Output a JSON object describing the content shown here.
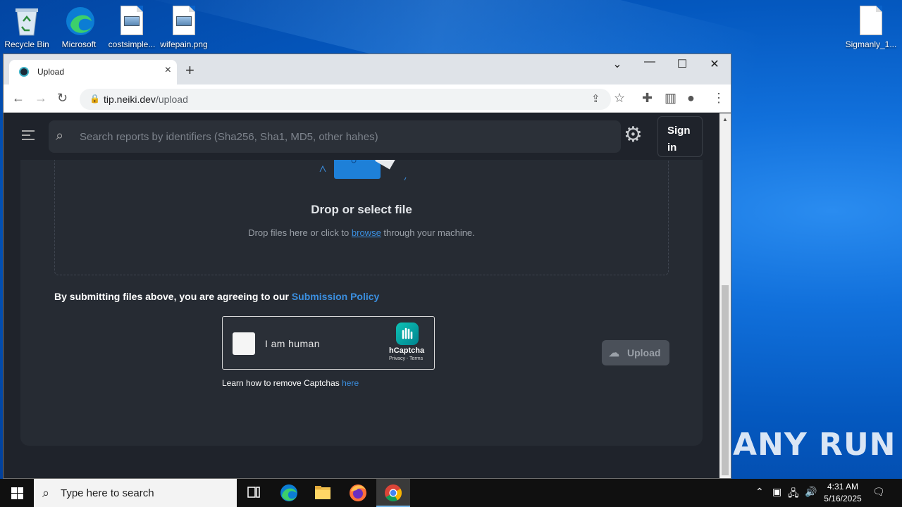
{
  "desktop": {
    "icons": [
      {
        "label": "Recycle Bin"
      },
      {
        "label": "Microsoft"
      },
      {
        "label": "costsimple..."
      },
      {
        "label": "wifepain.png"
      },
      {
        "label": "Sigmanly_1..."
      }
    ],
    "watermark": "ANY RUN"
  },
  "browser": {
    "tab": {
      "title": "Upload"
    },
    "address": {
      "host": "tip.neiki.dev",
      "path": "/upload"
    }
  },
  "page": {
    "search": {
      "placeholder": "Search reports by identifiers (Sha256, Sha1, MD5, other hahes)"
    },
    "signin_label": "Sign in",
    "dropzone": {
      "title": "Drop or select file",
      "sub_before": "Drop files here or click to ",
      "sub_link": "browse",
      "sub_after": " through your machine."
    },
    "policy": {
      "text": "By submitting files above, you are agreeing to our ",
      "link": "Submission Policy"
    },
    "captcha": {
      "label": "I am human",
      "brand": "hCaptcha",
      "terms": "Privacy - Terms",
      "help_text": "Learn how to remove Captchas ",
      "help_link": "here"
    },
    "upload_label": "Upload"
  },
  "taskbar": {
    "search_placeholder": "Type here to search",
    "time": "4:31 AM",
    "date": "5/16/2025"
  },
  "colors": {
    "accent_link": "#3b8fe0",
    "page_bg": "#1f232b",
    "card_bg": "#262b33"
  }
}
